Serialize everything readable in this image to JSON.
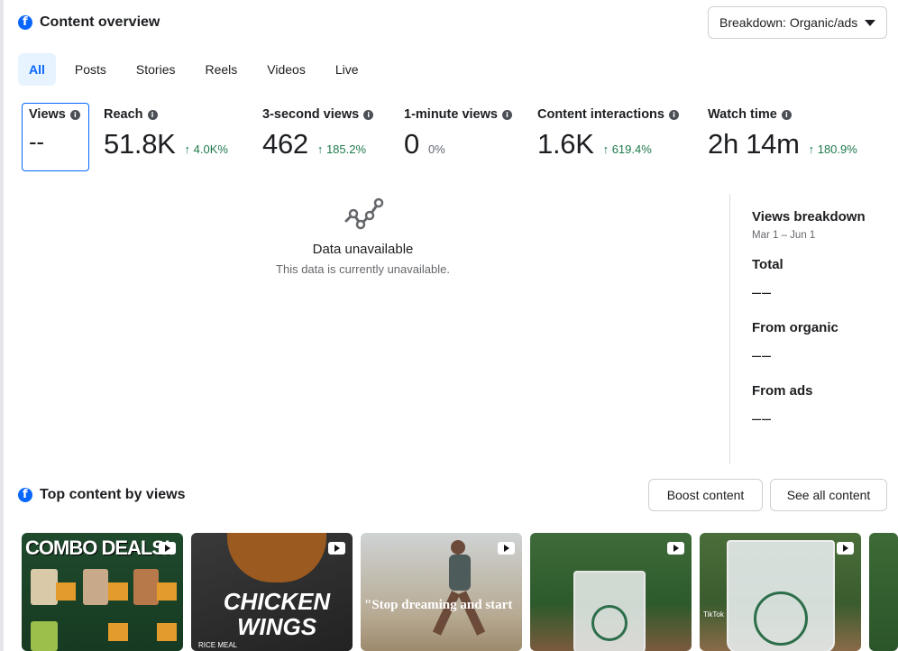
{
  "overview": {
    "title": "Content overview",
    "breakdown_label": "Breakdown: Organic/ads"
  },
  "tabs": [
    "All",
    "Posts",
    "Stories",
    "Reels",
    "Videos",
    "Live"
  ],
  "metrics": [
    {
      "label": "Views",
      "value": "--",
      "change": ""
    },
    {
      "label": "Reach",
      "value": "51.8K",
      "change": "↑ 4.0K%"
    },
    {
      "label": "3-second views",
      "value": "462",
      "change": "↑ 185.2%"
    },
    {
      "label": "1-minute views",
      "value": "0",
      "change": "0%"
    },
    {
      "label": "Content interactions",
      "value": "1.6K",
      "change": "↑ 619.4%"
    },
    {
      "label": "Watch time",
      "value": "2h 14m",
      "change": "↑ 180.9%"
    }
  ],
  "unavailable": {
    "title": "Data unavailable",
    "subtitle": "This data is currently unavailable."
  },
  "views_breakdown": {
    "title": "Views breakdown",
    "date_range": "Mar 1 – Jun 1",
    "rows": [
      {
        "label": "Total",
        "value": "––"
      },
      {
        "label": "From organic",
        "value": "––"
      },
      {
        "label": "From ads",
        "value": "––"
      }
    ]
  },
  "top_content": {
    "title": "Top content by views",
    "boost_label": "Boost content",
    "see_all_label": "See all content",
    "thumbnails": [
      {
        "caption": "COMBO DEALS!",
        "accent": "#1f4a2c"
      },
      {
        "caption": "CHICKEN WINGS",
        "sub": "RICE MEAL",
        "accent": "#2b2b2b"
      },
      {
        "caption": "\"Stop dreaming and start",
        "accent": "#b9b3a8"
      },
      {
        "caption": "",
        "accent": "#3f6b3a"
      },
      {
        "caption": "TikTok",
        "accent": "#4a6e3a"
      }
    ]
  },
  "colors": {
    "accent": "#0866ff",
    "positive": "#1e7a4c"
  }
}
